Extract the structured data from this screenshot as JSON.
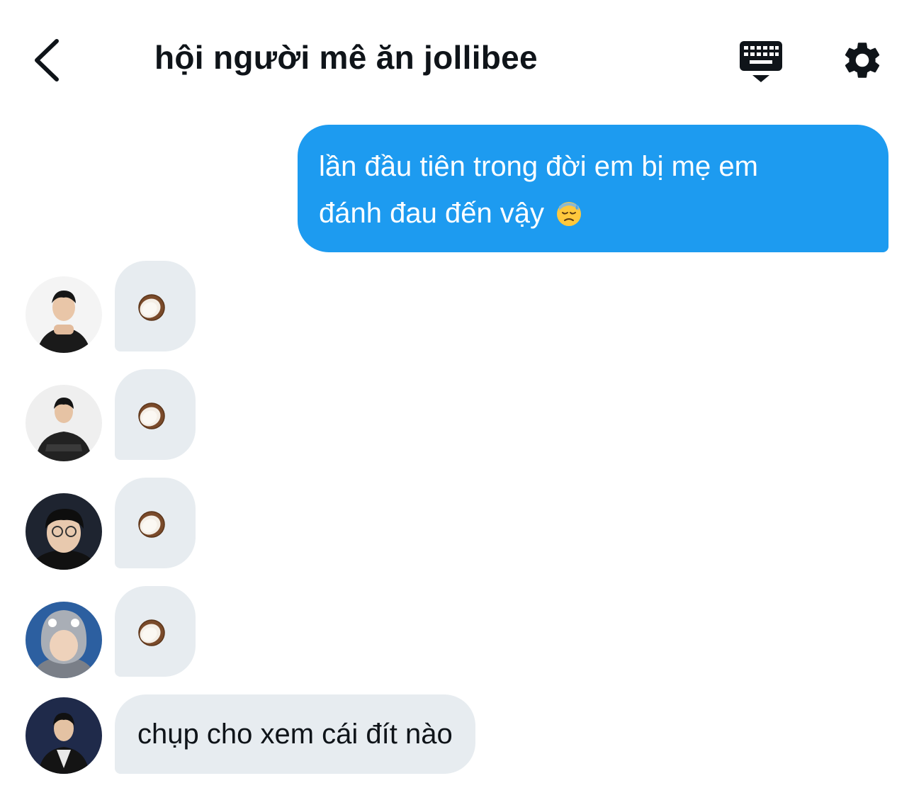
{
  "header": {
    "title": "hội người mê ăn jollibee",
    "back_icon": "chevron-left-icon",
    "keyboard_icon": "keyboard-icon",
    "settings_icon": "gear-icon"
  },
  "messages": [
    {
      "direction": "outgoing",
      "text_line1": "lần đầu tiên trong đời em bị mẹ em",
      "text_line2": "đánh đau đến vậy",
      "emoji": "downcast-sweat-emoji"
    },
    {
      "direction": "incoming",
      "content": "coconut-emoji"
    },
    {
      "direction": "incoming",
      "content": "coconut-emoji"
    },
    {
      "direction": "incoming",
      "content": "coconut-emoji"
    },
    {
      "direction": "incoming",
      "content": "coconut-emoji"
    },
    {
      "direction": "incoming",
      "text": "chụp cho xem cái đít nào"
    }
  ],
  "colors": {
    "outgoing_bubble": "#1d9bf0",
    "incoming_bubble": "#e7ecf0",
    "text": "#0f1419"
  }
}
